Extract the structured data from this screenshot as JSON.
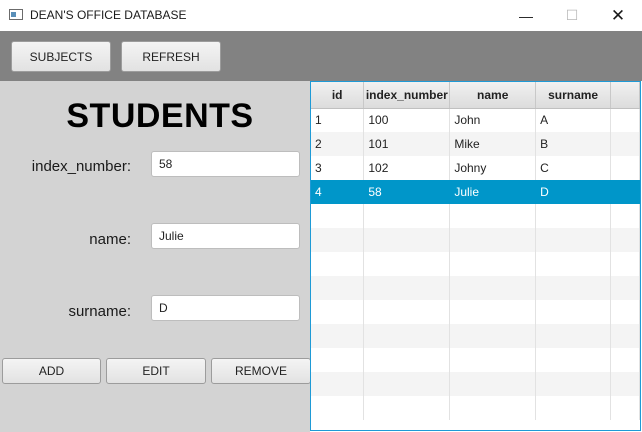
{
  "window": {
    "title": "DEAN'S OFFICE DATABASE",
    "minimize_glyph": "—",
    "maximize_glyph": "☐",
    "close_glyph": "✕"
  },
  "toolbar": {
    "subjects_label": "SUBJECTS",
    "refresh_label": "REFRESH"
  },
  "form": {
    "heading": "STUDENTS",
    "index_label": "index_number:",
    "index_value": "58",
    "name_label": "name:",
    "name_value": "Julie",
    "surname_label": "surname:",
    "surname_value": "D",
    "add_label": "ADD",
    "edit_label": "EDIT",
    "remove_label": "REMOVE"
  },
  "table": {
    "columns": [
      "id",
      "index_number",
      "name",
      "surname"
    ],
    "rows": [
      [
        "1",
        "100",
        "John",
        "A"
      ],
      [
        "2",
        "101",
        "Mike",
        "B"
      ],
      [
        "3",
        "102",
        "Johny",
        "C"
      ],
      [
        "4",
        "58",
        "Julie",
        "D"
      ]
    ],
    "selected_row": 3,
    "empty_rows": 9
  },
  "colors": {
    "toolbar_bg": "#828282",
    "panel_bg": "#d3d3d3",
    "selection": "#0096c9",
    "focus_border": "#1e9ad6"
  },
  "icons": {
    "app": "app-window-icon",
    "minimize": "minimize-icon",
    "maximize": "maximize-icon",
    "close": "close-icon"
  }
}
